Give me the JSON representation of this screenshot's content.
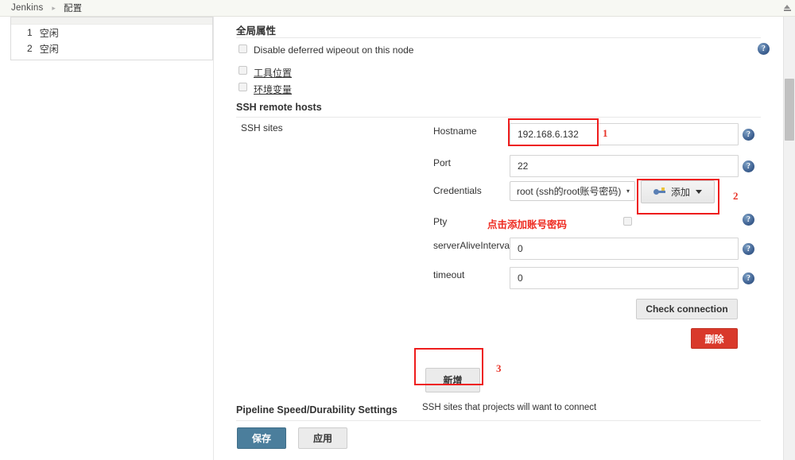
{
  "breadcrumb": {
    "root": "Jenkins",
    "separator": "▸",
    "current": "配置"
  },
  "sidebar": {
    "items": [
      {
        "num": "1",
        "label": "空闲"
      },
      {
        "num": "2",
        "label": "空闲"
      }
    ]
  },
  "main": {
    "global_properties_title": "全局属性",
    "checkboxes": [
      {
        "label": "Disable deferred wipeout on this node",
        "checked": false,
        "link": false
      },
      {
        "label": "工具位置",
        "checked": false,
        "link": true
      },
      {
        "label": "环境变量",
        "checked": false,
        "link": true
      }
    ],
    "ssh_remote_hosts_title": "SSH remote hosts",
    "ssh_sites_label": "SSH sites",
    "fields": {
      "hostname": {
        "label": "Hostname",
        "value": "192.168.6.132"
      },
      "port": {
        "label": "Port",
        "value": "22"
      },
      "credentials": {
        "label": "Credentials",
        "value": "root (ssh的root账号密码)",
        "caret": "▾"
      },
      "pty": {
        "label": "Pty",
        "checked": false
      },
      "server_alive_interval": {
        "label": "serverAliveInterval",
        "value": "0"
      },
      "timeout": {
        "label": "timeout",
        "value": "0"
      }
    },
    "buttons": {
      "add_credentials": "添加",
      "check_connection": "Check connection",
      "delete": "删除",
      "add_site": "新增",
      "save": "保存",
      "apply": "应用"
    },
    "help_icon_glyph": "?",
    "hint_text": "SSH sites that projects will want to connect",
    "pipeline_title": "Pipeline Speed/Durability Settings"
  },
  "annotations": {
    "marker_1": "1",
    "marker_2": "2",
    "marker_3": "3",
    "pty_note": "点击添加账号密码",
    "box_color": "#ee1c1c",
    "text_color": "#ee2b21"
  },
  "colors": {
    "save_button": "#4b7e9c",
    "delete_button": "#d9392b",
    "breadcrumb_bg": "#f7f8f3"
  }
}
